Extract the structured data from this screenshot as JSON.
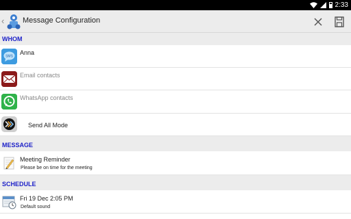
{
  "status_bar": {
    "time": "2:33"
  },
  "action_bar": {
    "title": "Message Configuration"
  },
  "sections": {
    "whom": "WHOM",
    "message": "MESSAGE",
    "schedule": "SCHEDULE"
  },
  "whom": {
    "sms_contact": "Anna",
    "sms_icon_text": "SMS",
    "email": "Email contacts",
    "whatsapp": "WhatsApp contacts",
    "send_all_mode": "Send All Mode"
  },
  "message": {
    "title": "Meeting Reminder",
    "body": "Please be on time for the meeting"
  },
  "schedule": {
    "datetime": "Fri 19 Dec 2:05 PM",
    "sound": "Default sound"
  },
  "colors": {
    "section_header": "#1e22c8",
    "email_icon_bg": "#8b1a1a",
    "whatsapp_icon_bg": "#2fb24a",
    "sms_icon_bg": "#3d9be0"
  }
}
